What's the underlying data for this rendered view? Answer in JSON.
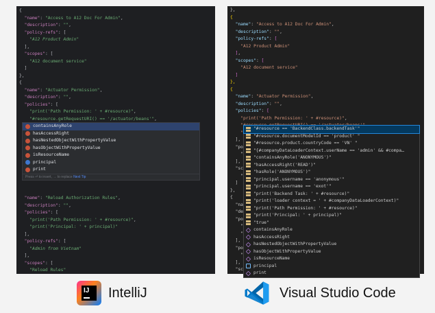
{
  "intellij": {
    "code_lines": [
      [
        [
          "p",
          "{"
        ]
      ],
      [
        [
          "p",
          "  "
        ],
        [
          "k",
          "\"name\""
        ],
        [
          "p",
          ": "
        ],
        [
          "s",
          "\"Access to A12 Doc For Admin\""
        ],
        [
          "p",
          ","
        ]
      ],
      [
        [
          "p",
          "  "
        ],
        [
          "k",
          "\"description\""
        ],
        [
          "p",
          ": "
        ],
        [
          "s",
          "\"\""
        ],
        [
          "p",
          ","
        ]
      ],
      [
        [
          "p",
          "  "
        ],
        [
          "k",
          "\"policy-refs\""
        ],
        [
          "p",
          ": ["
        ]
      ],
      [
        [
          "p",
          "    "
        ],
        [
          "i",
          "\"A12 Product Admin\""
        ]
      ],
      [
        [
          "p",
          "  ],"
        ]
      ],
      [
        [
          "p",
          "  "
        ],
        [
          "k",
          "\"scopes\""
        ],
        [
          "p",
          ": ["
        ]
      ],
      [
        [
          "p",
          "    "
        ],
        [
          "s",
          "\"A12 document service\""
        ]
      ],
      [
        [
          "p",
          "  ]"
        ]
      ],
      [
        [
          "p",
          "},"
        ]
      ],
      [
        [
          "p",
          "{"
        ]
      ],
      [
        [
          "p",
          "  "
        ],
        [
          "k",
          "\"name\""
        ],
        [
          "p",
          ": "
        ],
        [
          "s",
          "\"Actuator Permission\""
        ],
        [
          "p",
          ","
        ]
      ],
      [
        [
          "p",
          "  "
        ],
        [
          "k",
          "\"description\""
        ],
        [
          "p",
          ": "
        ],
        [
          "s",
          "\"\""
        ],
        [
          "p",
          ","
        ]
      ],
      [
        [
          "p",
          "  "
        ],
        [
          "k",
          "\"policies\""
        ],
        [
          "p",
          ": ["
        ]
      ],
      [
        [
          "p",
          "    "
        ],
        [
          "s",
          "\"print('Path Permission: ' + #resource)\""
        ],
        [
          "p",
          ","
        ]
      ],
      [
        [
          "p",
          "    "
        ],
        [
          "s",
          "\"#resource.getRequestURI() == '/actuator/beans'\""
        ],
        [
          "p",
          ","
        ]
      ],
      [
        [
          "p",
          "    "
        ],
        [
          "s",
          "\"|\""
        ]
      ],
      [
        [
          "p",
          ""
        ]
      ],
      [
        [
          "p",
          ""
        ]
      ],
      [
        [
          "p",
          ""
        ]
      ],
      [
        [
          "p",
          ""
        ]
      ],
      [
        [
          "p",
          ""
        ]
      ],
      [
        [
          "p",
          ""
        ]
      ],
      [
        [
          "p",
          ""
        ]
      ],
      [
        [
          "p",
          ""
        ]
      ],
      [
        [
          "p",
          ""
        ]
      ],
      [
        [
          "p",
          "  "
        ],
        [
          "k",
          "\"name\""
        ],
        [
          "p",
          ": "
        ],
        [
          "s",
          "\"Reload Authorization Rules\""
        ],
        [
          "p",
          ","
        ]
      ],
      [
        [
          "p",
          "  "
        ],
        [
          "k",
          "\"description\""
        ],
        [
          "p",
          ": "
        ],
        [
          "s",
          "\"\""
        ],
        [
          "p",
          ","
        ]
      ],
      [
        [
          "p",
          "  "
        ],
        [
          "k",
          "\"policies\""
        ],
        [
          "p",
          ": ["
        ]
      ],
      [
        [
          "p",
          "    "
        ],
        [
          "s",
          "\"print('Path Permission: ' + #resource)\""
        ],
        [
          "p",
          ","
        ]
      ],
      [
        [
          "p",
          "    "
        ],
        [
          "s",
          "\"print('Principal: ' + principal)\""
        ]
      ],
      [
        [
          "p",
          "  ],"
        ]
      ],
      [
        [
          "p",
          "  "
        ],
        [
          "k",
          "\"policy-refs\""
        ],
        [
          "p",
          ": ["
        ]
      ],
      [
        [
          "p",
          "    "
        ],
        [
          "i",
          "\"Admin from Vietnam\""
        ]
      ],
      [
        [
          "p",
          "  ],"
        ]
      ],
      [
        [
          "p",
          "  "
        ],
        [
          "k",
          "\"scopes\""
        ],
        [
          "p",
          ": ["
        ]
      ],
      [
        [
          "p",
          "    "
        ],
        [
          "s",
          "\"Reload Rules\""
        ]
      ],
      [
        [
          "p",
          "  ]"
        ]
      ]
    ],
    "popup": {
      "items": [
        {
          "label": "containsAnyRole",
          "icon": "method-icon",
          "selected": true
        },
        {
          "label": "hasAccessRight",
          "icon": "method-icon",
          "selected": false
        },
        {
          "label": "hasNestedObjectWithPropertyValue",
          "icon": "method-icon",
          "selected": false
        },
        {
          "label": "hasObjectWithPropertyValue",
          "icon": "method-icon",
          "selected": false
        },
        {
          "label": "isResourceName",
          "icon": "method-icon",
          "selected": false
        },
        {
          "label": "principal",
          "icon": "field-icon",
          "selected": false
        },
        {
          "label": "print",
          "icon": "method-icon",
          "selected": false
        }
      ],
      "hint": "Press ⏎ to insert, → to replace",
      "next_tip": "Next Tip"
    }
  },
  "vscode": {
    "code_lines": [
      [
        [
          "p",
          "},"
        ]
      ],
      [
        [
          "b",
          "{"
        ]
      ],
      [
        [
          "p",
          "  "
        ],
        [
          "k",
          "\"name\""
        ],
        [
          "p",
          ": "
        ],
        [
          "s",
          "\"Access to A12 Doc For Admin\""
        ],
        [
          "p",
          ","
        ]
      ],
      [
        [
          "p",
          "  "
        ],
        [
          "k",
          "\"description\""
        ],
        [
          "p",
          ": "
        ],
        [
          "s",
          "\"\""
        ],
        [
          "p",
          ","
        ]
      ],
      [
        [
          "p",
          "  "
        ],
        [
          "k",
          "\"policy-refs\""
        ],
        [
          "p",
          ": "
        ],
        [
          "b2",
          "["
        ]
      ],
      [
        [
          "p",
          "    "
        ],
        [
          "s",
          "\"A12 Product Admin\""
        ]
      ],
      [
        [
          "p",
          "  "
        ],
        [
          "b2",
          "]"
        ],
        [
          "p",
          ","
        ]
      ],
      [
        [
          "p",
          "  "
        ],
        [
          "k",
          "\"scopes\""
        ],
        [
          "p",
          ": "
        ],
        [
          "b2",
          "["
        ]
      ],
      [
        [
          "p",
          "    "
        ],
        [
          "s",
          "\"A12 document service\""
        ]
      ],
      [
        [
          "p",
          "  "
        ],
        [
          "b2",
          "]"
        ]
      ],
      [
        [
          "b",
          "},"
        ]
      ],
      [
        [
          "b",
          "{"
        ]
      ],
      [
        [
          "p",
          "  "
        ],
        [
          "k",
          "\"name\""
        ],
        [
          "p",
          ": "
        ],
        [
          "s",
          "\"Actuator Permission\""
        ],
        [
          "p",
          ","
        ]
      ],
      [
        [
          "p",
          "  "
        ],
        [
          "k",
          "\"description\""
        ],
        [
          "p",
          ": "
        ],
        [
          "s",
          "\"\""
        ],
        [
          "p",
          ","
        ]
      ],
      [
        [
          "p",
          "  "
        ],
        [
          "k",
          "\"policies\""
        ],
        [
          "p",
          ": "
        ],
        [
          "b2",
          "["
        ]
      ],
      [
        [
          "p",
          "    "
        ],
        [
          "s",
          "\"print('Path Permission: ' + #resource)\""
        ],
        [
          "p",
          ","
        ]
      ],
      [
        [
          "p",
          "    "
        ],
        [
          "s",
          "\"#resource.getRequestURI() == '/actuator/beans'\""
        ],
        [
          "p",
          ","
        ]
      ],
      [
        [
          "p",
          "    "
        ],
        [
          "s",
          "\"\""
        ]
      ],
      [
        [
          "p",
          "  ],"
        ]
      ],
      [
        [
          "p",
          "  \"po"
        ]
      ],
      [
        [
          "p",
          "    \""
        ]
      ],
      [
        [
          "p",
          "  ],"
        ]
      ],
      [
        [
          "p",
          "  \"sc"
        ]
      ],
      [
        [
          "p",
          "    \""
        ]
      ],
      [
        [
          "p",
          "  ]"
        ]
      ],
      [
        [
          "p",
          "},"
        ]
      ],
      [
        [
          "p",
          "{"
        ]
      ],
      [
        [
          "p",
          "  \"na"
        ]
      ],
      [
        [
          "p",
          "  \"de"
        ]
      ],
      [
        [
          "p",
          "  \"po"
        ]
      ],
      [
        [
          "p",
          "    \""
        ]
      ],
      [
        [
          "p",
          "    \""
        ]
      ],
      [
        [
          "p",
          "  ],"
        ]
      ],
      [
        [
          "p",
          "  \"po"
        ]
      ],
      [
        [
          "p",
          "    \""
        ]
      ],
      [
        [
          "p",
          "  ],"
        ]
      ],
      [
        [
          "p",
          "  \"sc"
        ]
      ],
      [
        [
          "p",
          "    \""
        ]
      ],
      [
        [
          "p",
          "  ]"
        ]
      ]
    ],
    "popup": {
      "items": [
        {
          "label": "\"#resource == 'BackendClass.backendTask'\"",
          "icon": "snippet-icon",
          "selected": true
        },
        {
          "label": "\"#resource.documentModelId == 'product' \"",
          "icon": "snippet-icon",
          "selected": false
        },
        {
          "label": "\"#resource.product.countryCode == 'VN' \"",
          "icon": "snippet-icon",
          "selected": false
        },
        {
          "label": "\"{#companyDataLoaderContext.userName == 'admin' && #compa…",
          "icon": "snippet-icon",
          "selected": false
        },
        {
          "label": "\"containsAnyRole('ANONYMOUS')\"",
          "icon": "snippet-icon",
          "selected": false
        },
        {
          "label": "\"hasAccessRight('READ')\"",
          "icon": "snippet-icon",
          "selected": false
        },
        {
          "label": "\"hasRole('ANONYMOUS')\"",
          "icon": "snippet-icon",
          "selected": false
        },
        {
          "label": "\"principal.username == 'anonymous'\"",
          "icon": "snippet-icon",
          "selected": false
        },
        {
          "label": "\"principal.username == 'exot'\"",
          "icon": "snippet-icon",
          "selected": false
        },
        {
          "label": "\"print('Backend Task: ' + #resource)\"",
          "icon": "snippet-icon",
          "selected": false
        },
        {
          "label": "\"print('loader context = ' + #companyDataLoaderContext)\"",
          "icon": "snippet-icon",
          "selected": false
        },
        {
          "label": "\"print('Path Permission: ' + #resource)\"",
          "icon": "snippet-icon",
          "selected": false
        },
        {
          "label": "\"print('Principal: ' + principal)\"",
          "icon": "snippet-icon",
          "selected": false
        },
        {
          "label": "\"true\"",
          "icon": "snippet-icon",
          "selected": false
        },
        {
          "label": "containsAnyRole",
          "icon": "method-icon",
          "selected": false
        },
        {
          "label": "hasAccessRight",
          "icon": "method-icon",
          "selected": false
        },
        {
          "label": "hasNestedObjectWithPropertyValue",
          "icon": "method-icon",
          "selected": false
        },
        {
          "label": "hasObjectWithPropertyValue",
          "icon": "method-icon",
          "selected": false
        },
        {
          "label": "isResourceName",
          "icon": "method-icon",
          "selected": false
        },
        {
          "label": "principal",
          "icon": "variable-icon",
          "selected": false
        },
        {
          "label": "print",
          "icon": "method-icon",
          "selected": false
        }
      ]
    }
  },
  "labels": {
    "intellij": "IntelliJ",
    "vscode": "Visual Studio Code",
    "intellij_logo_text": "IJ"
  },
  "colors": {
    "intellij_bg": "#1e1f22",
    "vscode_bg": "#1f1f1f",
    "vscode_accent": "#2488db"
  }
}
